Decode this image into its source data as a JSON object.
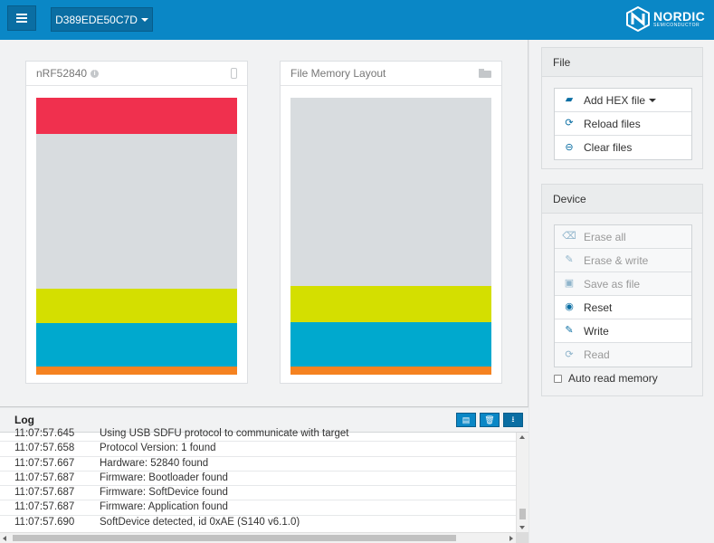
{
  "topbar": {
    "menu_icon": "hamburger-icon",
    "device_label": "D389EDE50C7D",
    "logo_word": "NORDIC",
    "logo_sub": "SEMICONDUCTOR",
    "color": "#0a87c6"
  },
  "device_card": {
    "title": "nRF52840",
    "info_icon": "info-icon",
    "chip_icon": "chip-icon",
    "segments": [
      {
        "color": "#f0304e",
        "start": 0.0,
        "end": 0.13
      },
      {
        "color": "#d8dcdf",
        "start": 0.13,
        "end": 0.69
      },
      {
        "color": "#d4df00",
        "start": 0.69,
        "end": 0.815
      },
      {
        "color": "#00a9ce",
        "start": 0.815,
        "end": 0.97
      },
      {
        "color": "#f58220",
        "start": 0.97,
        "end": 1.0
      }
    ]
  },
  "file_card": {
    "title": "File Memory Layout",
    "folder_icon": "folder-open-icon",
    "segments": [
      {
        "color": "#d8dcdf",
        "start": 0.0,
        "end": 0.68
      },
      {
        "color": "#d4df00",
        "start": 0.68,
        "end": 0.81
      },
      {
        "color": "#00a9ce",
        "start": 0.81,
        "end": 0.97
      },
      {
        "color": "#f58220",
        "start": 0.97,
        "end": 1.0
      }
    ]
  },
  "sidebar": {
    "file_panel": {
      "title": "File",
      "buttons": [
        {
          "label": "Add HEX file",
          "icon": "folder-open-icon",
          "glyph": "▰",
          "disabled": false
        },
        {
          "label": "Reload files",
          "icon": "refresh-icon",
          "glyph": "⟳",
          "disabled": false
        },
        {
          "label": "Clear files",
          "icon": "minus-circle-icon",
          "glyph": "⊖",
          "disabled": false
        }
      ]
    },
    "device_panel": {
      "title": "Device",
      "buttons": [
        {
          "label": "Erase all",
          "icon": "eraser-icon",
          "glyph": "⌫",
          "disabled": true
        },
        {
          "label": "Erase & write",
          "icon": "pencil-icon",
          "glyph": "✎",
          "disabled": true
        },
        {
          "label": "Save as file",
          "icon": "floppy-icon",
          "glyph": "▣",
          "disabled": true
        },
        {
          "label": "Reset",
          "icon": "target-icon",
          "glyph": "◉",
          "disabled": false
        },
        {
          "label": "Write",
          "icon": "pencil-icon",
          "glyph": "✎",
          "disabled": false
        },
        {
          "label": "Read",
          "icon": "refresh-icon",
          "glyph": "⟳",
          "disabled": true
        }
      ],
      "auto_read_label": "Auto read memory",
      "auto_read_checked": false
    }
  },
  "log": {
    "title": "Log",
    "actions": [
      "open-log-icon",
      "trash-icon",
      "autoscroll-icon"
    ],
    "entries": [
      {
        "time": "11:07:57.645",
        "message": "Using USB SDFU protocol to communicate with target"
      },
      {
        "time": "11:07:57.658",
        "message": "Protocol Version: 1 found"
      },
      {
        "time": "11:07:57.667",
        "message": "Hardware: 52840 found"
      },
      {
        "time": "11:07:57.687",
        "message": "Firmware: Bootloader found"
      },
      {
        "time": "11:07:57.687",
        "message": "Firmware: SoftDevice found"
      },
      {
        "time": "11:07:57.687",
        "message": "Firmware: Application found"
      },
      {
        "time": "11:07:57.690",
        "message": "SoftDevice detected, id 0xAE (S140 v6.1.0)"
      }
    ]
  }
}
